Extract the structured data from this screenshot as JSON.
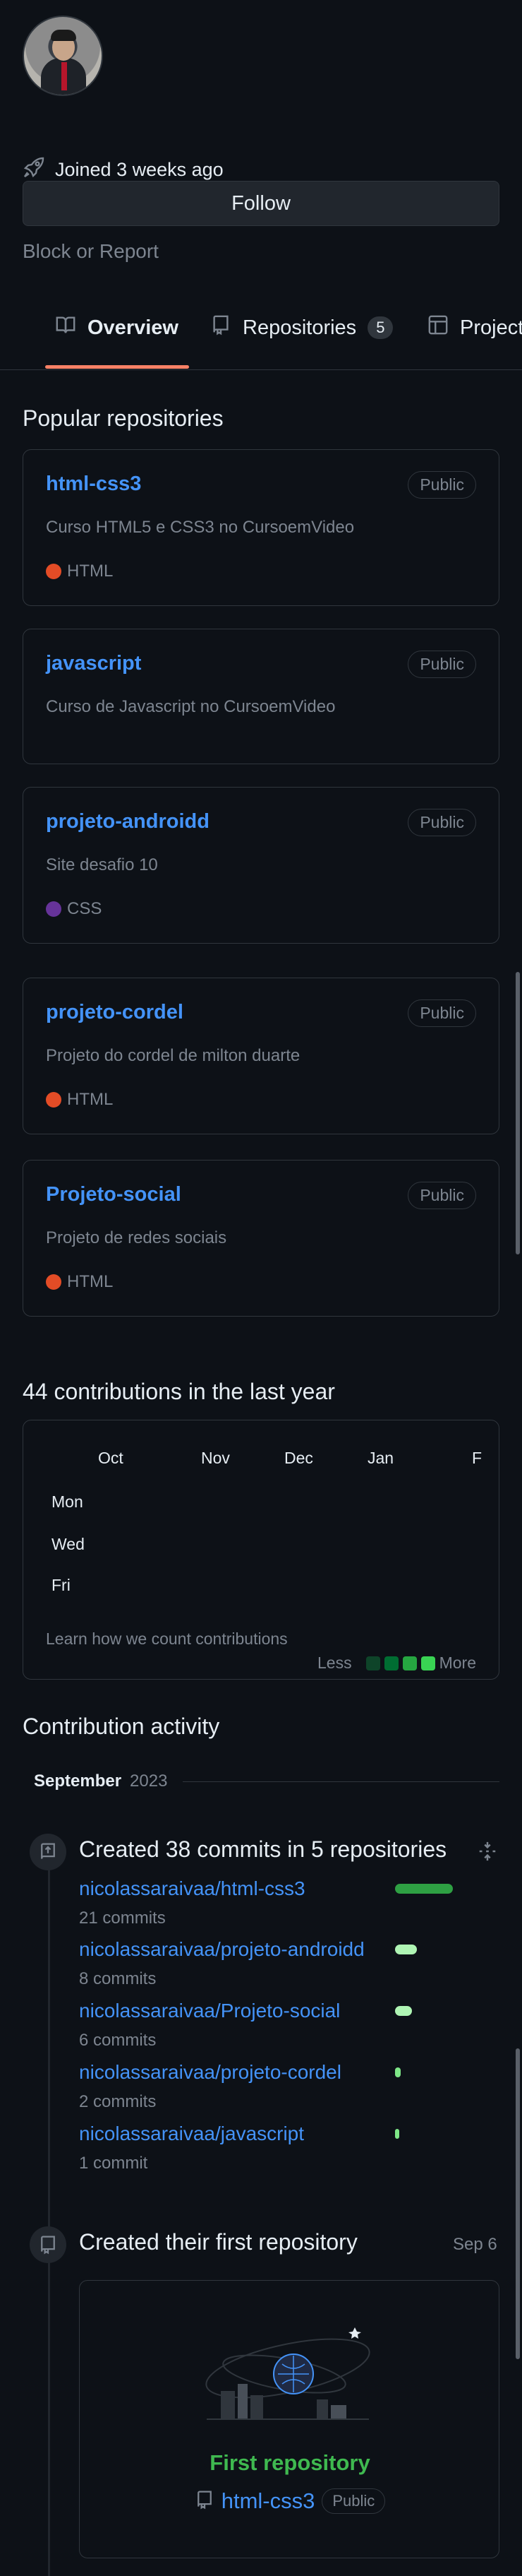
{
  "profile": {
    "joined": "Joined 3 weeks ago",
    "follow_label": "Follow",
    "block_label": "Block or Report"
  },
  "tabs": [
    {
      "label": "Overview",
      "icon": "book-icon",
      "active": true
    },
    {
      "label": "Repositories",
      "icon": "repo-icon",
      "count": "5"
    },
    {
      "label": "Projects",
      "icon": "table-icon"
    }
  ],
  "popular": {
    "heading": "Popular repositories",
    "repos": [
      {
        "name": "html-css3",
        "visibility": "Public",
        "description": "Curso HTML5 e CSS3 no CursoemVideo",
        "language": "HTML",
        "lang_color": "#e34c26"
      },
      {
        "name": "javascript",
        "visibility": "Public",
        "description": "Curso de Javascript no CursoemVideo",
        "language": "",
        "lang_color": ""
      },
      {
        "name": "projeto-androidd",
        "visibility": "Public",
        "description": "Site desafio 10",
        "language": "CSS",
        "lang_color": "#663399"
      },
      {
        "name": "projeto-cordel",
        "visibility": "Public",
        "description": "Projeto do cordel de milton duarte",
        "language": "HTML",
        "lang_color": "#e34c26"
      },
      {
        "name": "Projeto-social",
        "visibility": "Public",
        "description": "Projeto de redes sociais",
        "language": "HTML",
        "lang_color": "#e34c26"
      }
    ]
  },
  "contributions": {
    "heading": "44 contributions in the last year",
    "months": [
      "Oct",
      "Nov",
      "Dec",
      "Jan",
      "F"
    ],
    "days": [
      "Mon",
      "Wed",
      "Fri"
    ],
    "learn": "Learn how we count contributions",
    "less": "Less",
    "more": "More",
    "legend_colors": [
      "#0e4429",
      "#006d32",
      "#26a641",
      "#39d353"
    ]
  },
  "activity": {
    "heading": "Contribution activity",
    "month": "September",
    "year": "2023",
    "commits": {
      "title": "Created 38 commits in 5 repositories",
      "items": [
        {
          "repo": "nicolassaraivaa/html-css3",
          "commits": "21 commits",
          "share": 1.0
        },
        {
          "repo": "nicolassaraivaa/projeto-androidd",
          "commits": "8 commits",
          "share": 0.38
        },
        {
          "repo": "nicolassaraivaa/Projeto-social",
          "commits": "6 commits",
          "share": 0.29
        },
        {
          "repo": "nicolassaraivaa/projeto-cordel",
          "commits": "2 commits",
          "share": 0.1
        },
        {
          "repo": "nicolassaraivaa/javascript",
          "commits": "1 commit",
          "share": 0.05
        }
      ]
    },
    "first_repo": {
      "title": "Created their first repository",
      "date": "Sep 6",
      "label": "First repository",
      "repo": "html-css3",
      "visibility": "Public"
    }
  },
  "colors": {
    "bg": "#0d1117",
    "border": "#30363d",
    "link": "#4493f8",
    "tab_underline": "#f78166",
    "green": "#2ea043"
  }
}
